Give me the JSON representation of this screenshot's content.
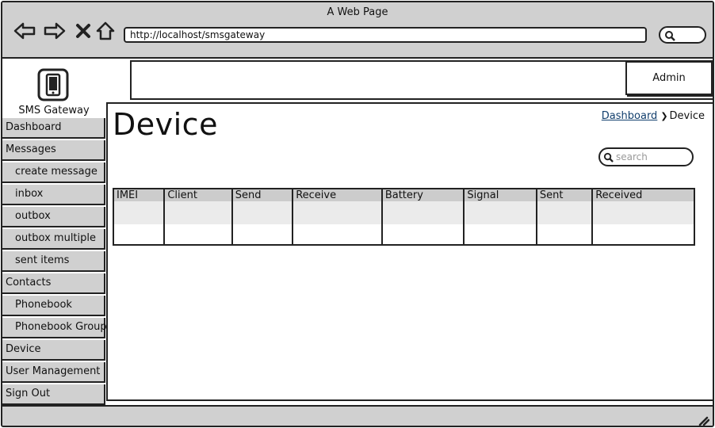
{
  "window": {
    "title": "A Web Page"
  },
  "browser": {
    "url": "http://localhost/smsgateway",
    "icons": [
      "back-arrow-icon",
      "forward-arrow-icon",
      "close-icon",
      "home-icon",
      "search-icon"
    ]
  },
  "app": {
    "name": "SMS Gateway",
    "logo_icon": "phone-icon"
  },
  "header": {
    "user_label": "Admin"
  },
  "sidebar": {
    "items": [
      {
        "label": "Dashboard",
        "sub": false
      },
      {
        "label": "Messages",
        "sub": false
      },
      {
        "label": "create message",
        "sub": true
      },
      {
        "label": "inbox",
        "sub": true
      },
      {
        "label": "outbox",
        "sub": true
      },
      {
        "label": "outbox multiple",
        "sub": true
      },
      {
        "label": "sent items",
        "sub": true
      },
      {
        "label": "Contacts",
        "sub": false
      },
      {
        "label": "Phonebook",
        "sub": true
      },
      {
        "label": "Phonebook Groups",
        "sub": true
      },
      {
        "label": "Device",
        "sub": false
      },
      {
        "label": "User Management",
        "sub": false
      },
      {
        "label": "Sign Out",
        "sub": false
      }
    ]
  },
  "main": {
    "title": "Device",
    "breadcrumb": {
      "link": "Dashboard",
      "current": "Device"
    },
    "search_placeholder": "search",
    "table": {
      "columns": [
        "IMEI",
        "Client",
        "Send",
        "Receive",
        "Battery",
        "Signal",
        "Sent",
        "Received"
      ],
      "rows": []
    }
  },
  "colors": {
    "chrome_gray": "#d0d0d0",
    "link_blue": "#123f6d",
    "border": "#222222"
  }
}
